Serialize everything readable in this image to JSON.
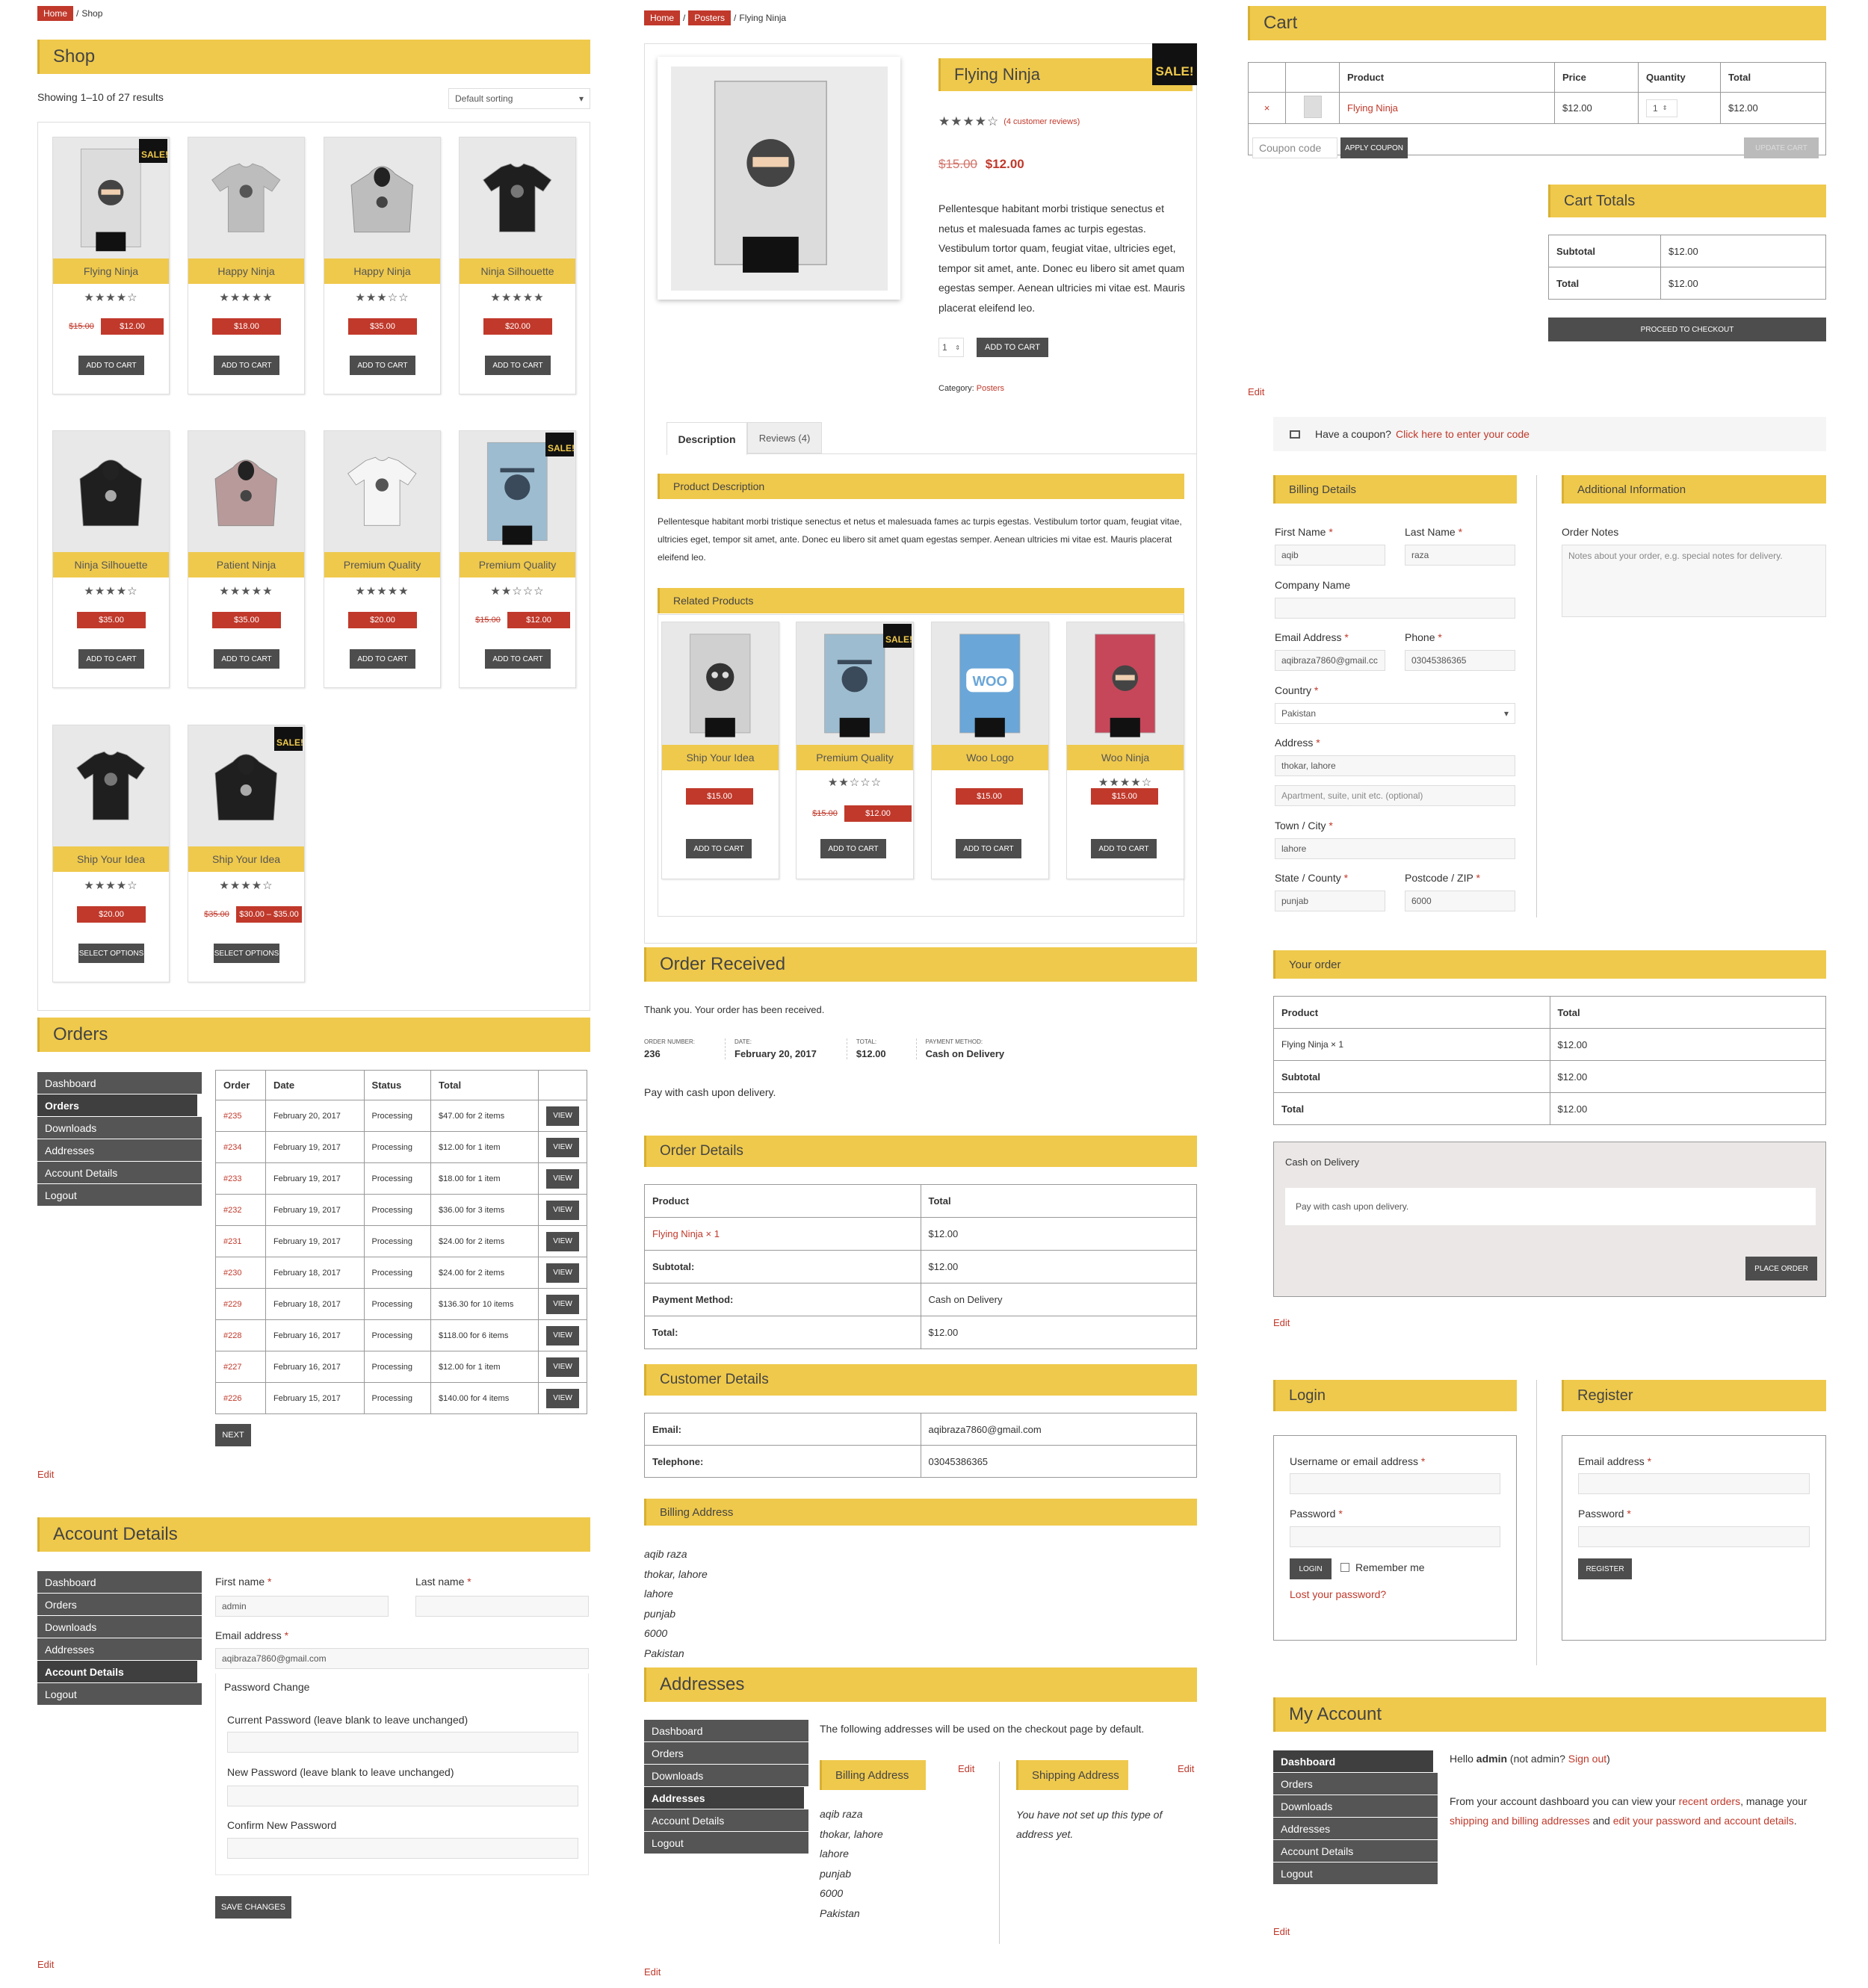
{
  "shop": {
    "breadcrumb_home": "Home",
    "breadcrumb_current": "Shop",
    "title": "Shop",
    "result_count": "Showing 1–10 of 27 results",
    "sorting": "Default sorting",
    "sale_badge": "SALE!",
    "products": [
      {
        "name": "Flying Ninja",
        "rating": 4,
        "old_price": "$15.00",
        "price": "$12.00",
        "button": "ADD TO CART",
        "sale": true,
        "kind": "poster-ninja"
      },
      {
        "name": "Happy Ninja",
        "rating": 5,
        "old_price": "",
        "price": "$18.00",
        "button": "ADD TO CART",
        "sale": false,
        "kind": "tshirt-grey"
      },
      {
        "name": "Happy Ninja",
        "rating": 3,
        "old_price": "",
        "price": "$35.00",
        "button": "ADD TO CART",
        "sale": false,
        "kind": "hoodie-grey"
      },
      {
        "name": "Ninja Silhouette",
        "rating": 5,
        "old_price": "",
        "price": "$20.00",
        "button": "ADD TO CART",
        "sale": false,
        "kind": "tshirt-black"
      },
      {
        "name": "Ninja Silhouette",
        "rating": 4,
        "old_price": "",
        "price": "$35.00",
        "button": "ADD TO CART",
        "sale": false,
        "kind": "hoodie-black"
      },
      {
        "name": "Patient Ninja",
        "rating": 5,
        "old_price": "",
        "price": "$35.00",
        "button": "ADD TO CART",
        "sale": false,
        "kind": "hoodie-pink"
      },
      {
        "name": "Premium Quality",
        "rating": 5,
        "old_price": "",
        "price": "$20.00",
        "button": "ADD TO CART",
        "sale": false,
        "kind": "tshirt-white"
      },
      {
        "name": "Premium Quality",
        "rating": 2,
        "old_price": "$15.00",
        "price": "$12.00",
        "button": "ADD TO CART",
        "sale": true,
        "kind": "poster-blue"
      },
      {
        "name": "Ship Your Idea",
        "rating": 4,
        "old_price": "",
        "price": "$20.00",
        "button": "SELECT OPTIONS",
        "sale": false,
        "kind": "tshirt-black"
      },
      {
        "name": "Ship Your Idea",
        "rating": 4,
        "old_price": "$35.00",
        "price": "$30.00 – $35.00",
        "button": "SELECT OPTIONS",
        "sale": true,
        "kind": "hoodie-black"
      }
    ]
  },
  "orders": {
    "title": "Orders",
    "nav": [
      "Dashboard",
      "Orders",
      "Downloads",
      "Addresses",
      "Account Details",
      "Logout"
    ],
    "headers": [
      "Order",
      "Date",
      "Status",
      "Total",
      ""
    ],
    "rows": [
      [
        "#235",
        "February 20, 2017",
        "Processing",
        "$47.00 for 2 items"
      ],
      [
        "#234",
        "February 19, 2017",
        "Processing",
        "$12.00 for 1 item"
      ],
      [
        "#233",
        "February 19, 2017",
        "Processing",
        "$18.00 for 1 item"
      ],
      [
        "#232",
        "February 19, 2017",
        "Processing",
        "$36.00 for 3 items"
      ],
      [
        "#231",
        "February 19, 2017",
        "Processing",
        "$24.00 for 2 items"
      ],
      [
        "#230",
        "February 18, 2017",
        "Processing",
        "$24.00 for 2 items"
      ],
      [
        "#229",
        "February 18, 2017",
        "Processing",
        "$136.30 for 10 items"
      ],
      [
        "#228",
        "February 16, 2017",
        "Processing",
        "$118.00 for 6 items"
      ],
      [
        "#227",
        "February 16, 2017",
        "Processing",
        "$12.00 for 1 item"
      ],
      [
        "#226",
        "February 15, 2017",
        "Processing",
        "$140.00 for 4 items"
      ]
    ],
    "view": "VIEW",
    "next": "NEXT",
    "edit": "Edit"
  },
  "account": {
    "title": "Account Details",
    "first_name_label": "First name",
    "last_name_label": "Last name",
    "first_name": "admin",
    "email_label": "Email address",
    "email": "aqibraza7860@gmail.com",
    "password_change": "Password Change",
    "current_pw": "Current Password (leave blank to leave unchanged)",
    "new_pw": "New Password (leave blank to leave unchanged)",
    "confirm_pw": "Confirm New Password",
    "save": "SAVE CHANGES",
    "edit": "Edit"
  },
  "product": {
    "breadcrumb_home": "Home",
    "breadcrumb_cat": "Posters",
    "breadcrumb_current": "Flying Ninja",
    "title": "Flying Ninja",
    "rating": 4,
    "reviews": "(4 customer reviews)",
    "old_price": "$15.00",
    "price": "$12.00",
    "description": "Pellentesque habitant morbi tristique senectus et netus et malesuada fames ac turpis egestas. Vestibulum tortor quam, feugiat vitae, ultricies eget, tempor sit amet, ante. Donec eu libero sit amet quam egestas semper. Aenean ultricies mi vitae est. Mauris placerat eleifend leo.",
    "qty": "1",
    "add": "ADD TO CART",
    "category_label": "Category:",
    "category": "Posters",
    "tab_desc": "Description",
    "tab_reviews": "Reviews (4)",
    "desc_heading": "Product Description",
    "long_desc": "Pellentesque habitant morbi tristique senectus et netus et malesuada fames ac turpis egestas. Vestibulum tortor quam, feugiat vitae, ultricies eget, tempor sit amet, ante. Donec eu libero sit amet quam egestas semper. Aenean ultricies mi vitae est. Mauris placerat eleifend leo.",
    "related_heading": "Related Products",
    "related": [
      {
        "name": "Ship Your Idea",
        "rating": 0,
        "old_price": "",
        "price": "$15.00",
        "sale": false,
        "kind": "poster-skull"
      },
      {
        "name": "Premium Quality",
        "rating": 2,
        "old_price": "$15.00",
        "price": "$12.00",
        "sale": true,
        "kind": "poster-blue"
      },
      {
        "name": "Woo Logo",
        "rating": 0,
        "old_price": "",
        "price": "$15.00",
        "sale": false,
        "kind": "poster-woo"
      },
      {
        "name": "Woo Ninja",
        "rating": 4,
        "old_price": "",
        "price": "$15.00",
        "sale": false,
        "kind": "poster-red"
      }
    ]
  },
  "received": {
    "title": "Order Received",
    "thanks": "Thank you. Your order has been received.",
    "meta": [
      {
        "k": "ORDER NUMBER:",
        "v": "236"
      },
      {
        "k": "DATE:",
        "v": "February 20, 2017"
      },
      {
        "k": "TOTAL:",
        "v": "$12.00"
      },
      {
        "k": "PAYMENT METHOD:",
        "v": "Cash on Delivery"
      }
    ],
    "pay_note": "Pay with cash upon delivery.",
    "details_title": "Order Details",
    "details": [
      [
        "Product",
        "Total"
      ],
      [
        "Flying Ninja × 1",
        "$12.00"
      ],
      [
        "Subtotal:",
        "$12.00"
      ],
      [
        "Payment Method:",
        "Cash on Delivery"
      ],
      [
        "Total:",
        "$12.00"
      ]
    ],
    "customer_title": "Customer Details",
    "customer": [
      [
        "Email:",
        "aqibraza7860@gmail.com"
      ],
      [
        "Telephone:",
        "03045386365"
      ]
    ],
    "billing_title": "Billing Address",
    "billing": [
      "aqib raza",
      "thokar, lahore",
      "lahore",
      "punjab",
      "6000",
      "Pakistan"
    ]
  },
  "addresses": {
    "title": "Addresses",
    "intro": "The following addresses will be used on the checkout page by default.",
    "billing": "Billing Address",
    "shipping": "Shipping Address",
    "edit": "Edit",
    "billing_lines": [
      "aqib raza",
      "thokar, lahore",
      "lahore",
      "punjab",
      "6000",
      "Pakistan"
    ],
    "shipping_empty": "You have not set up this type of address yet."
  },
  "cart": {
    "title": "Cart",
    "headers": [
      "",
      "",
      "Product",
      "Price",
      "Quantity",
      "Total"
    ],
    "item": {
      "remove": "×",
      "name": "Flying Ninja",
      "price": "$12.00",
      "qty": "1",
      "total": "$12.00"
    },
    "coupon_placeholder": "Coupon code",
    "apply": "APPLY COUPON",
    "update": "UPDATE CART",
    "totals_title": "Cart Totals",
    "subtotal_label": "Subtotal",
    "subtotal": "$12.00",
    "total_label": "Total",
    "total": "$12.00",
    "checkout": "PROCEED TO CHECKOUT",
    "edit": "Edit"
  },
  "checkout": {
    "coupon_text": "Have a coupon?",
    "coupon_link": "Click here to enter your code",
    "billing_title": "Billing Details",
    "additional_title": "Additional Information",
    "first": "First Name",
    "first_v": "aqib",
    "last": "Last Name",
    "last_v": "raza",
    "company": "Company Name",
    "email": "Email Address",
    "email_v": "aqibraza7860@gmail.cc",
    "phone": "Phone",
    "phone_v": "03045386365",
    "country": "Country",
    "country_v": "Pakistan",
    "address": "Address",
    "address_v": "thokar, lahore",
    "address2_ph": "Apartment, suite, unit etc. (optional)",
    "town": "Town / City",
    "town_v": "lahore",
    "state": "State / County",
    "state_v": "punjab",
    "postcode": "Postcode / ZIP",
    "postcode_v": "6000",
    "notes": "Order Notes",
    "notes_ph": "Notes about your order, e.g. special notes for delivery.",
    "your_order": "Your order",
    "order_rows": [
      [
        "Product",
        "Total"
      ],
      [
        "Flying Ninja × 1",
        "$12.00"
      ],
      [
        "Subtotal",
        "$12.00"
      ],
      [
        "Total",
        "$12.00"
      ]
    ],
    "cod": "Cash on Delivery",
    "cod_note": "Pay with cash upon delivery.",
    "place": "PLACE ORDER",
    "edit": "Edit"
  },
  "login": {
    "title": "Login",
    "register_title": "Register",
    "user": "Username or email address",
    "password": "Password",
    "login_btn": "LOGIN",
    "remember": "Remember me",
    "lost": "Lost your password?",
    "reg_email": "Email address",
    "reg_password": "Password",
    "register_btn": "REGISTER"
  },
  "myaccount": {
    "title": "My Account",
    "nav": [
      "Dashboard",
      "Orders",
      "Downloads",
      "Addresses",
      "Account Details",
      "Logout"
    ],
    "hello": "Hello",
    "user": "admin",
    "not": "(not admin?",
    "signout": "Sign out",
    "text_a": "From your account dashboard you can view your",
    "recent": "recent orders",
    "text_b": ", manage your",
    "shipping": "shipping and billing addresses",
    "text_c": "and",
    "edit_pw": "edit your password and account details",
    "dot": ".",
    "edit": "Edit"
  }
}
